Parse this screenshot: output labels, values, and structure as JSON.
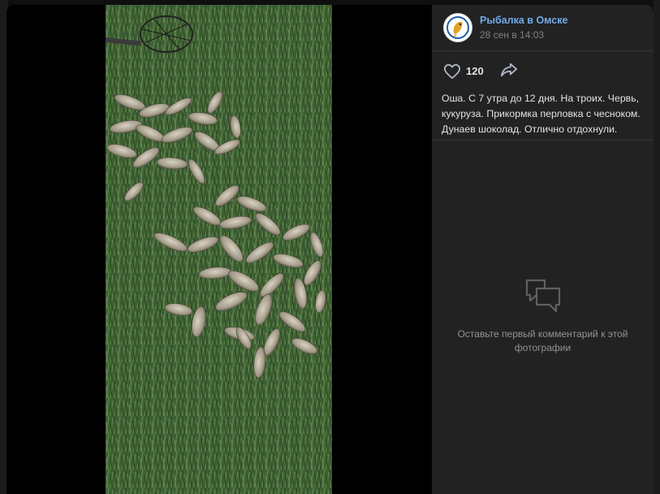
{
  "post": {
    "author": "Рыбалка в Омске",
    "date": "28 сен в 14:03",
    "likes": "120",
    "description": "Оша. С 7 утра до 12 дня. На троих. Червь, кукуруза. Прикормка перловка с чесноком. Дунаев шоколад. Отлично отдохнули."
  },
  "comments": {
    "empty_text": "Оставьте первый комментарий к этой фотографии"
  },
  "icons": {
    "like": "heart-icon",
    "share": "share-arrow-icon",
    "comments": "speech-bubble-icon"
  },
  "colors": {
    "accent": "#71aaeb",
    "panel": "#222222",
    "text": "#e1e3e6",
    "muted": "#828282"
  }
}
